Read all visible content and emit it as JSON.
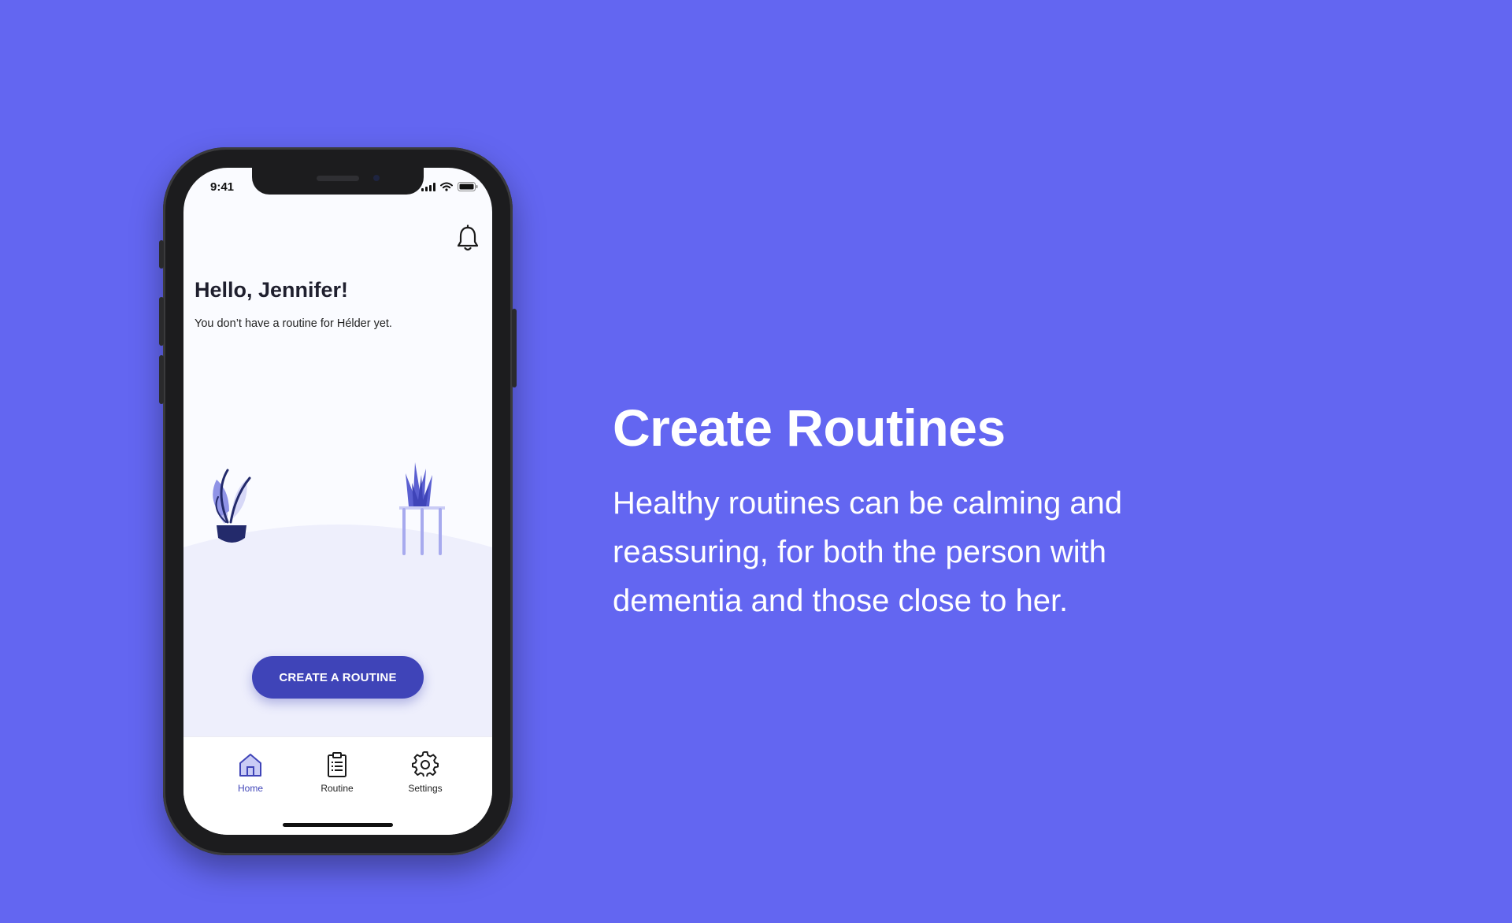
{
  "colors": {
    "background": "#6366f1",
    "accent": "#3f44b8",
    "plant_dark": "#232a6b",
    "plant_light": "#8f93e6"
  },
  "status_bar": {
    "time": "9:41"
  },
  "header": {
    "icon": "bell-icon"
  },
  "main": {
    "greeting": "Hello, Jennifer!",
    "subtext": "You don’t have a routine for Hélder yet.",
    "cta_label": "CREATE A ROUTINE"
  },
  "tabbar": {
    "items": [
      {
        "label": "Home",
        "icon": "home-icon",
        "active": true
      },
      {
        "label": "Routine",
        "icon": "clipboard-icon",
        "active": false
      },
      {
        "label": "Settings",
        "icon": "gear-icon",
        "active": false
      }
    ]
  },
  "promo": {
    "headline": "Create Routines",
    "body": "Healthy routines can be calming and reassuring, for both the person with dementia and those close to her."
  }
}
